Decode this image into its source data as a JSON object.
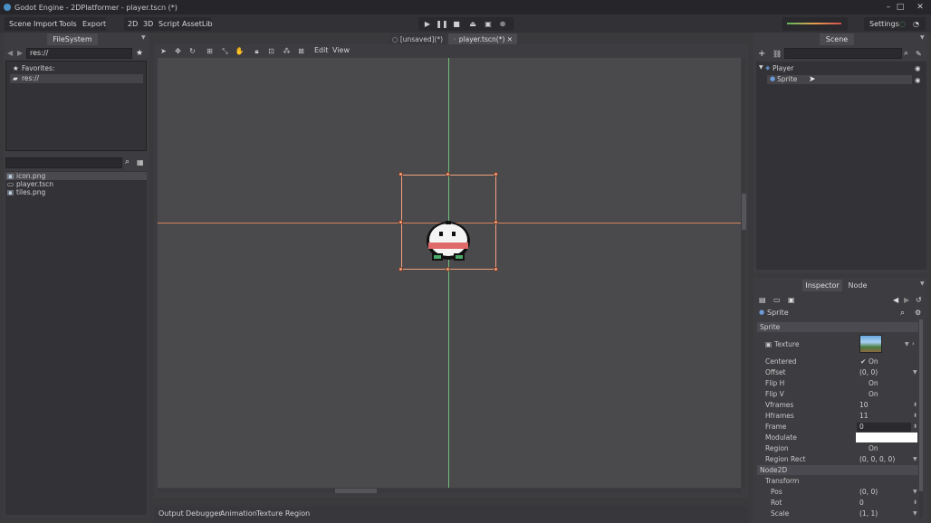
{
  "window": {
    "title": "Godot Engine - 2DPlatformer - player.tscn (*)",
    "controls": [
      "–",
      "□",
      "✕"
    ]
  },
  "menubar": {
    "menus": [
      "Scene",
      "Import",
      "Tools",
      "Export"
    ],
    "modes": [
      "2D",
      "3D",
      "Script",
      "AssetLib"
    ],
    "settings": "Settings"
  },
  "filesystem": {
    "tab": "FileSystem",
    "path": "res://",
    "favorites_label": "Favorites:",
    "root": "res://",
    "files": [
      "icon.png",
      "player.tscn",
      "tiles.png"
    ]
  },
  "scene_tabs": {
    "unsaved": "[unsaved](*)",
    "player": "player.tscn(*)"
  },
  "viewport_menu": {
    "edit": "Edit",
    "view": "View"
  },
  "scene_dock": {
    "tab": "Scene",
    "nodes": [
      "Player",
      "Sprite"
    ]
  },
  "inspector": {
    "tabs": [
      "Inspector",
      "Node"
    ],
    "object_name": "Sprite",
    "sections": {
      "sprite": "Sprite",
      "node2d": "Node2D",
      "transform": "Transform"
    },
    "texture_label": "Texture",
    "props": [
      {
        "label": "Centered",
        "value": "On",
        "checked": true
      },
      {
        "label": "Offset",
        "value": "(0, 0)"
      },
      {
        "label": "Flip H",
        "value": "On",
        "checked": false
      },
      {
        "label": "Flip V",
        "value": "On",
        "checked": false
      },
      {
        "label": "Vframes",
        "value": "10"
      },
      {
        "label": "Hframes",
        "value": "11"
      },
      {
        "label": "Frame",
        "value": "0"
      },
      {
        "label": "Modulate",
        "value": ""
      },
      {
        "label": "Region",
        "value": "On",
        "checked": false
      },
      {
        "label": "Region Rect",
        "value": "(0, 0, 0, 0)"
      }
    ],
    "transform_props": [
      {
        "label": "Pos",
        "value": "(0, 0)"
      },
      {
        "label": "Rot",
        "value": "0"
      },
      {
        "label": "Scale",
        "value": "(1, 1)"
      }
    ]
  },
  "bottom_tabs": [
    "Output",
    "Debugger",
    "Animation",
    "Texture Region"
  ],
  "colors": {
    "accent": "#4a8fc6",
    "selection": "#f1a07e",
    "guide_green": "#6ec079",
    "guide_orange": "#d8825e",
    "viewport_bg": "#4a4a4d"
  }
}
